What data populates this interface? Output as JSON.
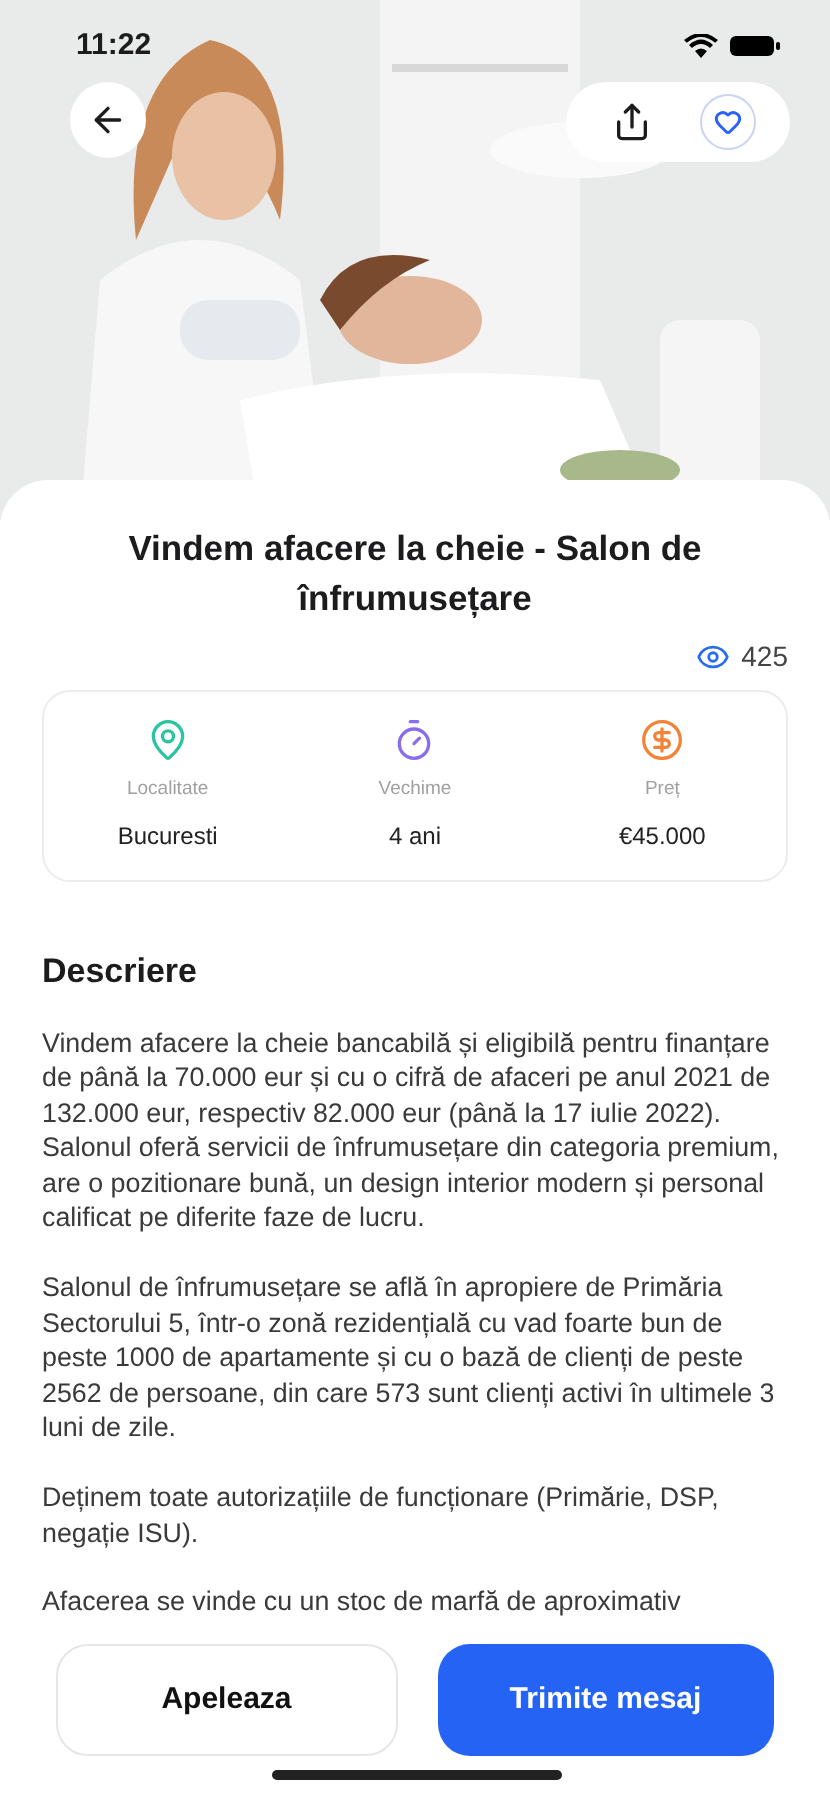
{
  "status_bar": {
    "time": "11:22"
  },
  "title": "Vindem afacere la cheie - Salon de înfrumusețare",
  "views": "425",
  "facts": [
    {
      "kind": "location",
      "label": "Localitate",
      "value": "Bucuresti"
    },
    {
      "kind": "age",
      "label": "Vechime",
      "value": "4 ani"
    },
    {
      "kind": "price",
      "label": "Preț",
      "value": "€45.000"
    }
  ],
  "description": {
    "heading": "Descriere",
    "paragraphs": [
      "Vindem afacere la cheie bancabilă și eligibilă pentru finanțare de până la 70.000 eur și cu o cifră de afaceri pe anul 2021 de 132.000 eur, respectiv 82.000 eur (până la 17 iulie 2022). Salonul oferă servicii de înfrumusețare din categoria premium, are o pozitionare bună, un design interior modern și personal calificat pe diferite faze de lucru.",
      "Salonul de înfrumusețare se află în apropiere de Primăria Sectorului 5, într-o zonă rezidențială cu vad foarte bun de peste 1000 de apartamente  și cu o bază de clienți de peste 2562 de persoane, din care 573 sunt clienți activi în ultimele 3 luni de zile.",
      "Deținem toate autorizațiile de funcționare (Primărie, DSP, negație ISU).",
      "Afacerea se vinde cu un stoc de marfă de aproximativ"
    ]
  },
  "actions": [
    {
      "kind": "secondary",
      "label": "Apeleaza"
    },
    {
      "kind": "primary",
      "label": "Trimite mesaj"
    }
  ]
}
